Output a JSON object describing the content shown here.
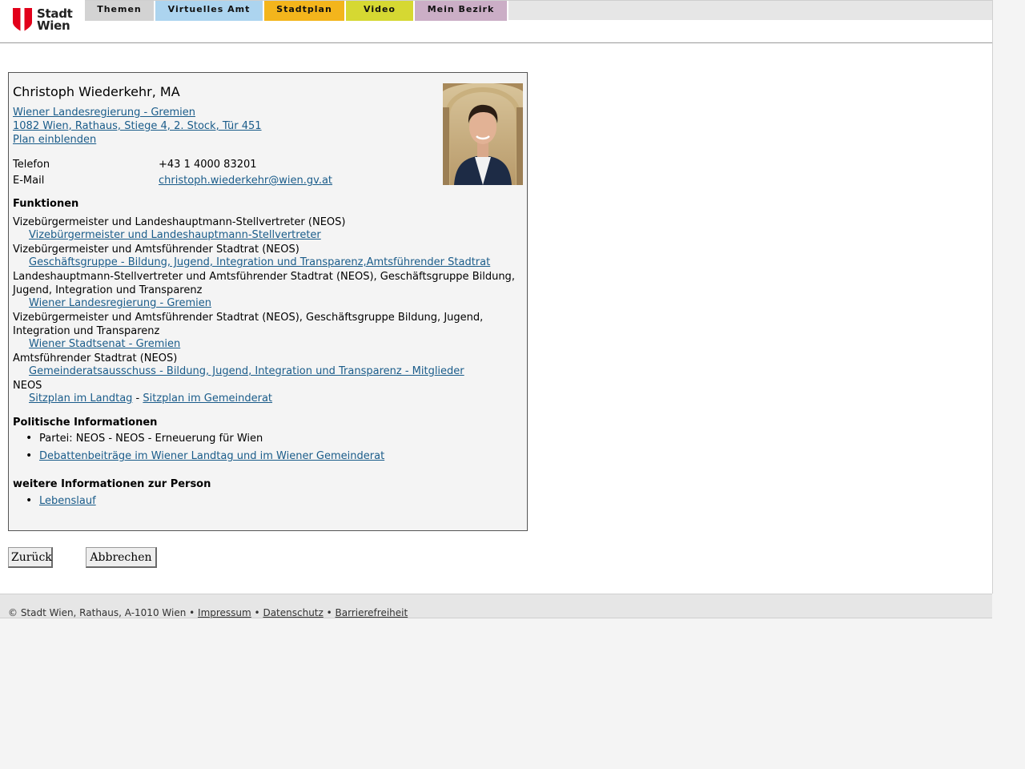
{
  "header": {
    "logo_line1": "Stadt",
    "logo_line2": "Wien",
    "nav": [
      {
        "label": "Themen",
        "color": "#d3d3d3"
      },
      {
        "label": "Virtuelles Amt",
        "color": "#acd4ef"
      },
      {
        "label": "Stadtplan",
        "color": "#f3b51c"
      },
      {
        "label": "Video",
        "color": "#d6d832"
      },
      {
        "label": "Mein Bezirk",
        "color": "#cbaec6"
      }
    ]
  },
  "person": {
    "name": "Christoph Wiederkehr, MA",
    "org_link": "Wiener Landesregierung - Gremien ",
    "address_link": "1082 Wien, Rathaus, Stiege 4, 2. Stock, Tür 451",
    "map_link": "Plan einblenden",
    "phone_label": "Telefon",
    "phone": "+43 1 4000 83201",
    "email_label": "E-Mail",
    "email": "christoph.wiederkehr@wien.gv.at"
  },
  "functions": {
    "heading": "Funktionen",
    "items": [
      {
        "text": "Vizebürgermeister und Landeshauptmann-Stellvertreter (NEOS)",
        "link": "Vizebürgermeister und Landeshauptmann-Stellvertreter"
      },
      {
        "text": "Vizebürgermeister und Amtsführender Stadtrat (NEOS)",
        "link": "Geschäftsgruppe - Bildung, Jugend, Integration und Transparenz,Amtsführender Stadtrat"
      },
      {
        "text": "Landeshauptmann-Stellvertreter und Amtsführender Stadtrat (NEOS), Geschäftsgruppe Bildung, Jugend, Integration und Transparenz",
        "link": "Wiener Landesregierung - Gremien"
      },
      {
        "text": "Vizebürgermeister und Amtsführender Stadtrat (NEOS), Geschäftsgruppe Bildung, Jugend, Integration und Transparenz",
        "link": "Wiener Stadtsenat - Gremien"
      },
      {
        "text": "Amtsführender Stadtrat (NEOS)",
        "link": "Gemeinderatsausschuss - Bildung, Jugend, Integration und Transparenz - Mitglieder"
      }
    ],
    "neos_text": "NEOS",
    "seat_link1": "Sitzplan im Landtag",
    "seat_sep": " - ",
    "seat_link2": "Sitzplan im Gemeinderat"
  },
  "political": {
    "heading": "Politische Informationen",
    "party": "Partei: NEOS - NEOS - Erneuerung für Wien",
    "debates_link": "Debattenbeiträge im Wiener Landtag und im Wiener Gemeinderat"
  },
  "more": {
    "heading": "weitere Informationen zur Person",
    "cv_link": "Lebenslauf"
  },
  "buttons": {
    "back": "Zurück",
    "cancel": "Abbrechen"
  },
  "footer": {
    "copyright": "© Stadt Wien, Rathaus, A-1010 Wien",
    "sep": " • ",
    "imprint": "Impressum",
    "privacy": "Datenschutz",
    "accessibility": "Barrierefreiheit"
  }
}
